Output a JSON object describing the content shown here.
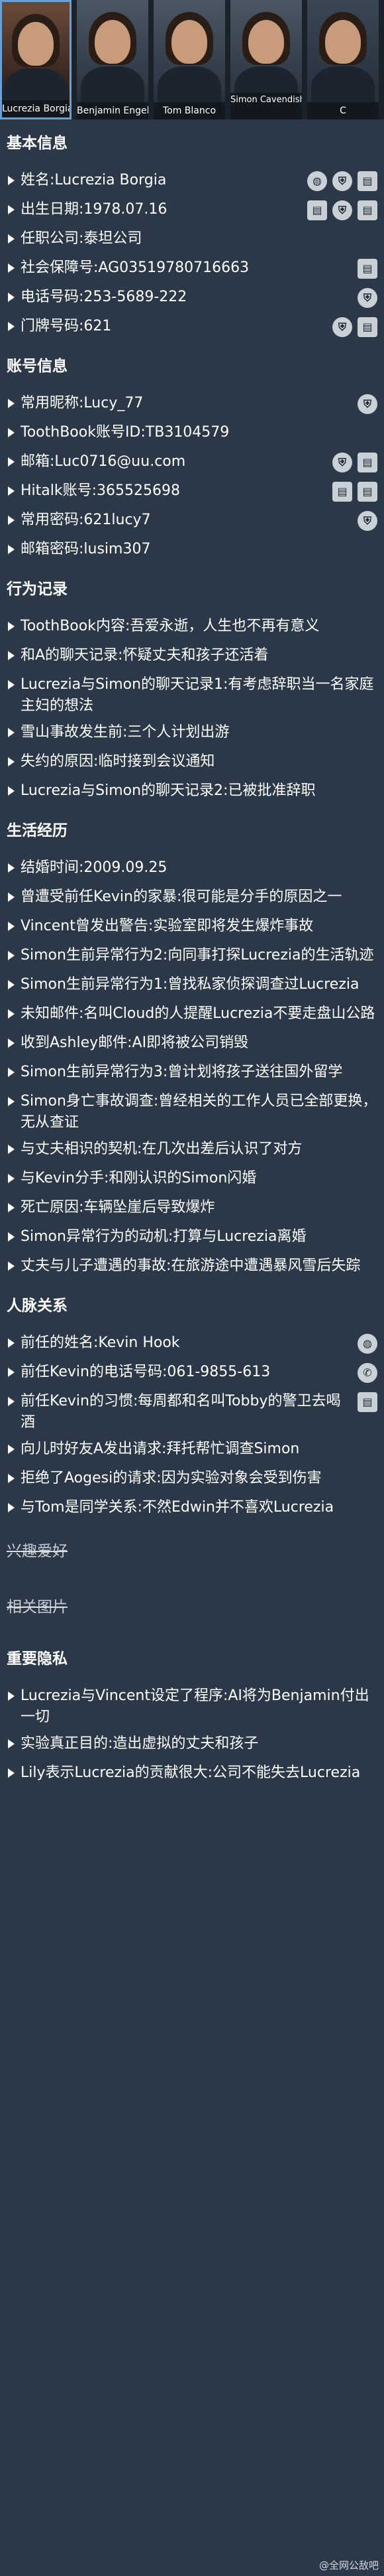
{
  "strip": {
    "cards": [
      {
        "name": "Lucrezia Borgia",
        "active": true
      },
      {
        "name": "Benjamin Engel",
        "active": false
      },
      {
        "name": "Tom Blanco",
        "active": false
      },
      {
        "name": "Simon\nCavendish",
        "active": false
      },
      {
        "name": "C",
        "active": false
      }
    ]
  },
  "basic": {
    "title": "基本信息",
    "items": [
      {
        "text": "姓名:Lucrezia Borgia",
        "icons": [
          "globe-icon",
          "shield-icon",
          "document-icon"
        ]
      },
      {
        "text": "出生日期:1978.07.16",
        "icons": [
          "document-icon",
          "shield-icon",
          "document-icon"
        ]
      },
      {
        "text": "任职公司:泰坦公司",
        "icons": []
      },
      {
        "text": "社会保障号:AG03519780716663",
        "icons": [
          "document-icon"
        ]
      },
      {
        "text": "电话号码:253-5689-222",
        "icons": [
          "shield-icon"
        ]
      },
      {
        "text": "门牌号码:621",
        "icons": [
          "shield-icon",
          "document-icon"
        ]
      }
    ]
  },
  "account": {
    "title": "账号信息",
    "items": [
      {
        "text": "常用昵称:Lucy_77",
        "icons": [
          "shield-icon"
        ]
      },
      {
        "text": "ToothBook账号ID:TB3104579",
        "icons": []
      },
      {
        "text": "邮箱:Luc0716@uu.com",
        "icons": [
          "shield-icon",
          "document-icon"
        ]
      },
      {
        "text": "Hitalk账号:365525698",
        "icons": [
          "document-icon",
          "document-icon"
        ]
      },
      {
        "text": "常用密码:621lucy7",
        "icons": [
          "shield-icon"
        ]
      },
      {
        "text": "邮箱密码:lusim307",
        "icons": []
      }
    ]
  },
  "behavior": {
    "title": "行为记录",
    "items": [
      {
        "text": "ToothBook内容:吾爱永逝，人生也不再有意义"
      },
      {
        "text": "和A的聊天记录:怀疑丈夫和孩子还活着"
      },
      {
        "text": "Lucrezia与Simon的聊天记录1:有考虑辞职当一名家庭主妇的想法"
      },
      {
        "text": "雪山事故发生前:三个人计划出游"
      },
      {
        "text": "失约的原因:临时接到会议通知"
      },
      {
        "text": "Lucrezia与Simon的聊天记录2:已被批准辞职"
      }
    ]
  },
  "life": {
    "title": "生活经历",
    "items": [
      {
        "text": "结婚时间:2009.09.25"
      },
      {
        "text": "曾遭受前任Kevin的家暴:很可能是分手的原因之一"
      },
      {
        "text": "Vincent曾发出警告:实验室即将发生爆炸事故"
      },
      {
        "text": "Simon生前异常行为2:向同事打探Lucrezia的生活轨迹"
      },
      {
        "text": "Simon生前异常行为1:曾找私家侦探调查过Lucrezia"
      },
      {
        "text": "未知邮件:名叫Cloud的人提醒Lucrezia不要走盘山公路"
      },
      {
        "text": "收到Ashley邮件:AI即将被公司销毁"
      },
      {
        "text": "Simon生前异常行为3:曾计划将孩子送往国外留学"
      },
      {
        "text": "Simon身亡事故调查:曾经相关的工作人员已全部更换，无从查证"
      },
      {
        "text": "与丈夫相识的契机:在几次出差后认识了对方"
      },
      {
        "text": "与Kevin分手:和刚认识的Simon闪婚"
      },
      {
        "text": "死亡原因:车辆坠崖后导致爆炸"
      },
      {
        "text": "Simon异常行为的动机:打算与Lucrezia离婚"
      },
      {
        "text": "丈夫与儿子遭遇的事故:在旅游途中遭遇暴风雪后失踪"
      }
    ]
  },
  "relations": {
    "title": "人脉关系",
    "items": [
      {
        "text": "前任的姓名:Kevin Hook",
        "icons": [
          "globe-icon"
        ]
      },
      {
        "text": "前任Kevin的电话号码:061-9855-613",
        "icons": [
          "phone-icon"
        ]
      },
      {
        "text": "前任Kevin的习惯:每周都和名叫Tobby的警卫去喝酒",
        "icons": [
          "document-icon"
        ]
      },
      {
        "text": "向儿时好友A发出请求:拜托帮忙调查Simon",
        "icons": []
      },
      {
        "text": "拒绝了Aogesi的请求:因为实验对象会受到伤害",
        "icons": []
      },
      {
        "text": "与Tom是同学关系:不然Edwin并不喜欢Lucrezia",
        "icons": []
      }
    ]
  },
  "collapsed": {
    "hobbies": "兴趣爱好",
    "images": "相关图片"
  },
  "privacy": {
    "title": "重要隐私",
    "items": [
      {
        "text": "Lucrezia与Vincent设定了程序:AI将为Benjamin付出一切"
      },
      {
        "text": "实验真正目的:造出虚拟的丈夫和孩子"
      },
      {
        "text": "Lily表示Lucrezia的贡献很大:公司不能失去Lucrezia"
      }
    ]
  },
  "watermark": "@全网公敌吧",
  "icon_glyphs": {
    "globe-icon": "◍",
    "shield-icon": "⛨",
    "document-icon": "▤",
    "phone-icon": "✆"
  }
}
